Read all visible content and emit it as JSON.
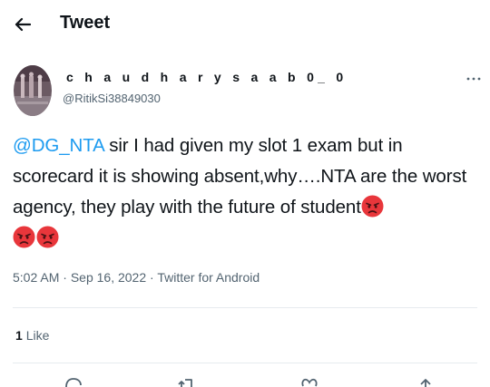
{
  "header": {
    "title": "Tweet",
    "back_icon": "arrow-left-icon"
  },
  "author": {
    "display_name": "c h a u d h a r y  s a a b 0_ 0",
    "handle": "@RitikSi38849030",
    "avatar_icon": "profile-photo"
  },
  "tweet": {
    "mention": "@DG_NTA",
    "text": " sir I had given my slot 1 exam but in scorecard it is showing absent,why….NTA are the worst agency, they play with the future of student",
    "emoji_icon": "angry-face-emoji",
    "emoji_count": 3
  },
  "meta": {
    "time": "5:02 AM",
    "separator": "·",
    "date": "Sep 16, 2022",
    "source": "Twitter for Android"
  },
  "stats": {
    "likes_count": "1",
    "likes_label": "Like"
  },
  "actions": [
    "reply-icon",
    "retweet-icon",
    "like-icon",
    "share-icon"
  ],
  "colors": {
    "accent": "#1d9bf0",
    "text": "#0f1419",
    "secondary": "#536471",
    "emoji": "#e8363b"
  }
}
